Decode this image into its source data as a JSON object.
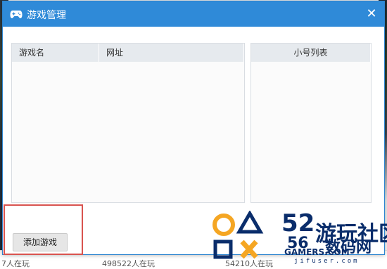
{
  "window": {
    "title": "游戏管理",
    "close_glyph": "✕"
  },
  "table": {
    "columns": [
      "游戏名",
      "网址"
    ],
    "rows": []
  },
  "accounts": {
    "header": "小号列表",
    "items": []
  },
  "buttons": {
    "add_game": "添加游戏"
  },
  "background": {
    "bottom_texts": [
      "7人在玩",
      "498522人在玩",
      "54210人在玩"
    ]
  },
  "watermark": {
    "number": "52",
    "name": "游玩社区",
    "site_number": "56",
    "site_name": "数码网",
    "gamers": "GAMERS.COM",
    "url": "jifuser.com",
    "colors": {
      "orange": "#f5a623",
      "navy": "#0a2d6b"
    }
  },
  "colors": {
    "titlebar": "#2f8ad8",
    "highlight": "#d9534f",
    "header_bg": "#e6eaee"
  },
  "icons": {
    "title": "gamepad-icon",
    "close": "close-icon"
  }
}
